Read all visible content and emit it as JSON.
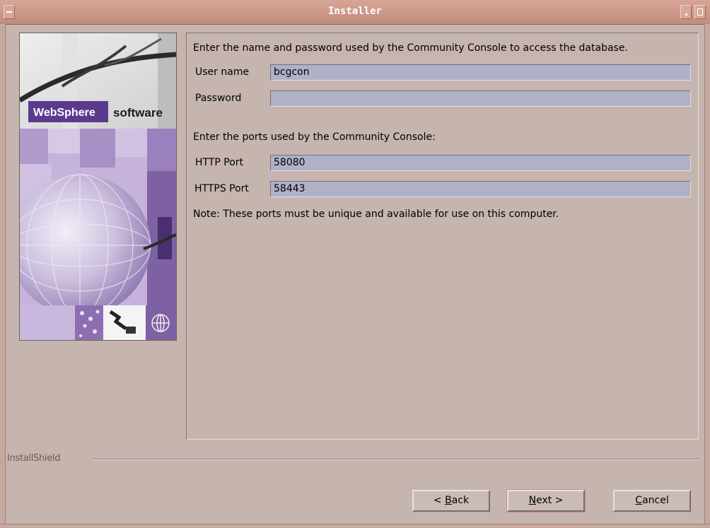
{
  "window": {
    "title": "Installer",
    "controls": [
      "window-menu-icon",
      "minimize-icon",
      "maximize-icon"
    ]
  },
  "banner": {
    "brand": "WebSphere",
    "brand_suffix": "software",
    "colors": {
      "brand_box": "#5b3a8e",
      "lavender": "#b9a3d0",
      "purple_dark": "#7e61a3"
    }
  },
  "form": {
    "db_prompt": "Enter the name and password used by the Community Console to access the database.",
    "username_label": "User name",
    "username_value": "bcgcon",
    "password_label": "Password",
    "password_value": "",
    "ports_prompt": "Enter the ports used by the Community Console:",
    "http_label": "HTTP Port",
    "http_value": "58080",
    "https_label": "HTTPS Port",
    "https_value": "58443",
    "note": "Note: These ports must be unique and available for use on this computer."
  },
  "footer": {
    "installshield": "InstallShield",
    "back_prefix": "< ",
    "back_key": "B",
    "back_rest": "ack",
    "next_key": "N",
    "next_rest": "ext >",
    "cancel_key": "C",
    "cancel_rest": "ancel"
  }
}
